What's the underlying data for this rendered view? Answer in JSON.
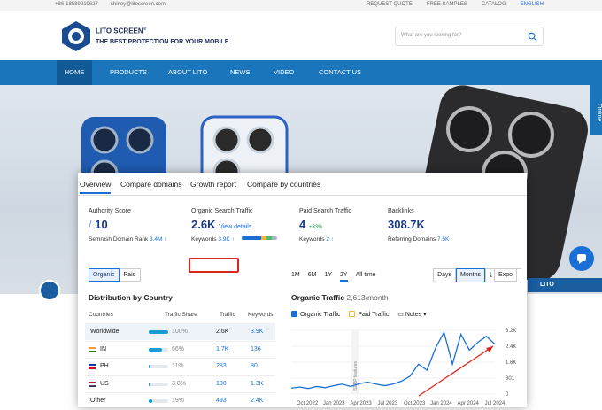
{
  "topbar": {
    "phone": "+86-18589219627",
    "email": "shirley@litoscreen.com",
    "links": [
      "REQUEST QUOTE",
      "FREE SAMPLES",
      "CATALOG",
      "ENGLISH"
    ]
  },
  "header": {
    "brand": "LITO SCREEN",
    "reg": "®",
    "tagline": "THE BEST PROTECTION FOR YOUR MOBILE",
    "search_placeholder": "What are you looking for?"
  },
  "nav": [
    "HOME",
    "PRODUCTS",
    "ABOUT LITO",
    "NEWS",
    "VIDEO",
    "CONTACT US"
  ],
  "side": {
    "online": "Online",
    "lito": "LITO"
  },
  "semrush": {
    "tabs": [
      "Overview",
      "Compare domains",
      "Growth report",
      "Compare by countries"
    ],
    "metrics": [
      {
        "title": "Authority Score",
        "value": "10",
        "sub": "Semrush Domain Rank",
        "sub_val": "3.4M"
      },
      {
        "title": "Organic Search Traffic",
        "value": "2.6K",
        "link": "View details",
        "sub": "Keywords",
        "sub_val": "3.9K"
      },
      {
        "title": "Paid Search Traffic",
        "value": "4",
        "delta": "+33%",
        "sub": "Keywords",
        "sub_val": "2"
      },
      {
        "title": "Backlinks",
        "value": "308.7K",
        "sub": "Referring Domains",
        "sub_val": "7.5K"
      }
    ],
    "seg": [
      "Organic",
      "Paid"
    ],
    "dist_title": "Distribution by Country",
    "cols": [
      "Countries",
      "Traffic Share",
      "Traffic",
      "Keywords"
    ],
    "rows": [
      {
        "country": "Worldwide",
        "share": "100%",
        "pct": 100,
        "traffic": "2.6K",
        "kw": "3.9K"
      },
      {
        "country": "IN",
        "share": "66%",
        "pct": 66,
        "traffic": "1.7K",
        "kw": "136"
      },
      {
        "country": "PH",
        "share": "11%",
        "pct": 11,
        "traffic": "283",
        "kw": "80"
      },
      {
        "country": "US",
        "share": "3.8%",
        "pct": 4,
        "traffic": "100",
        "kw": "1.3K"
      },
      {
        "country": "Other",
        "share": "19%",
        "pct": 19,
        "traffic": "493",
        "kw": "2.4K"
      }
    ],
    "ranges": [
      "1M",
      "6M",
      "1Y",
      "2Y",
      "All time"
    ],
    "days": [
      "Days",
      "Months",
      "Expo"
    ],
    "traffic_title": "Organic Traffic",
    "traffic_sub": "2,613/month",
    "legend": [
      "Organic Traffic",
      "Paid Traffic",
      "Notes"
    ],
    "serp": "SERP features"
  },
  "chart_data": {
    "type": "line",
    "x": [
      "Oct 2022",
      "Jan 2023",
      "Apr 2023",
      "Jul 2023",
      "Oct 2023",
      "Jan 2024",
      "Apr 2024",
      "Jul 2024"
    ],
    "yticks": [
      "3.2K",
      "2.4K",
      "1.6K",
      "801",
      "0"
    ],
    "ylim": [
      0,
      3200
    ],
    "series": [
      {
        "name": "Organic Traffic",
        "values": [
          300,
          350,
          280,
          380,
          320,
          420,
          500,
          380,
          520,
          600,
          500,
          420,
          500,
          650,
          900,
          1500,
          1200,
          2300,
          3100,
          1500,
          3000,
          2200,
          2600,
          2900,
          2500
        ]
      }
    ]
  }
}
